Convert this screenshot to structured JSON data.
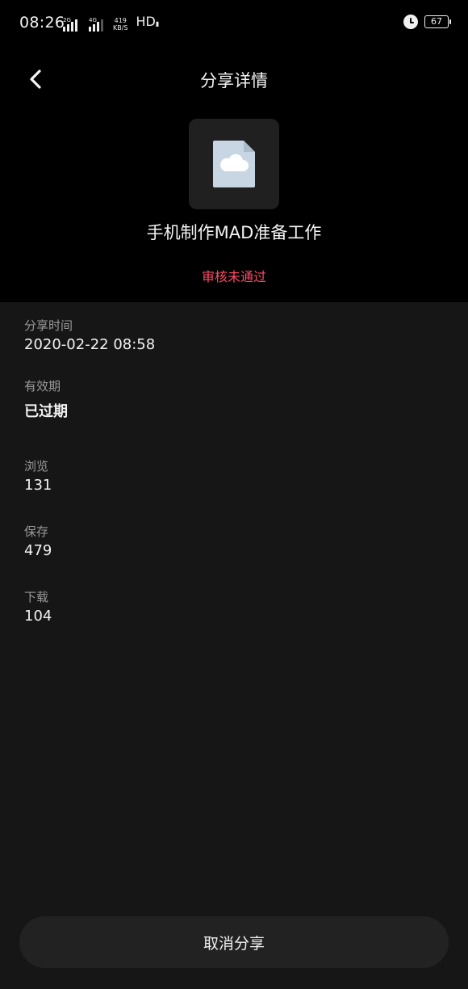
{
  "status_bar": {
    "time": "08:26",
    "signal_1_tag": "2G",
    "signal_2_tag": "4G",
    "net_speed_value": "419",
    "net_speed_unit": "KB/S",
    "hd_label": "HD",
    "battery_level": "67"
  },
  "header": {
    "title": "分享详情",
    "file_name": "手机制作MAD准备工作",
    "audit_status": "审核未通过"
  },
  "details": [
    {
      "label": "分享时间",
      "value": "2020-02-22 08:58"
    },
    {
      "label": "有效期",
      "value": "已过期"
    },
    {
      "label": "浏览",
      "value": "131"
    },
    {
      "label": "保存",
      "value": "479"
    },
    {
      "label": "下载",
      "value": "104"
    }
  ],
  "actions": {
    "cancel_share_label": "取消分享"
  },
  "colors": {
    "header_bg": "#000000",
    "body_bg": "#161616",
    "audit_status": "#ff4a66",
    "button_bg": "#222222",
    "file_icon": "#c7d6e2"
  },
  "icons": {
    "back": "chevron-left-icon",
    "file": "cloud-file-icon",
    "alarm": "alarm-clock-icon",
    "battery": "battery-icon"
  }
}
